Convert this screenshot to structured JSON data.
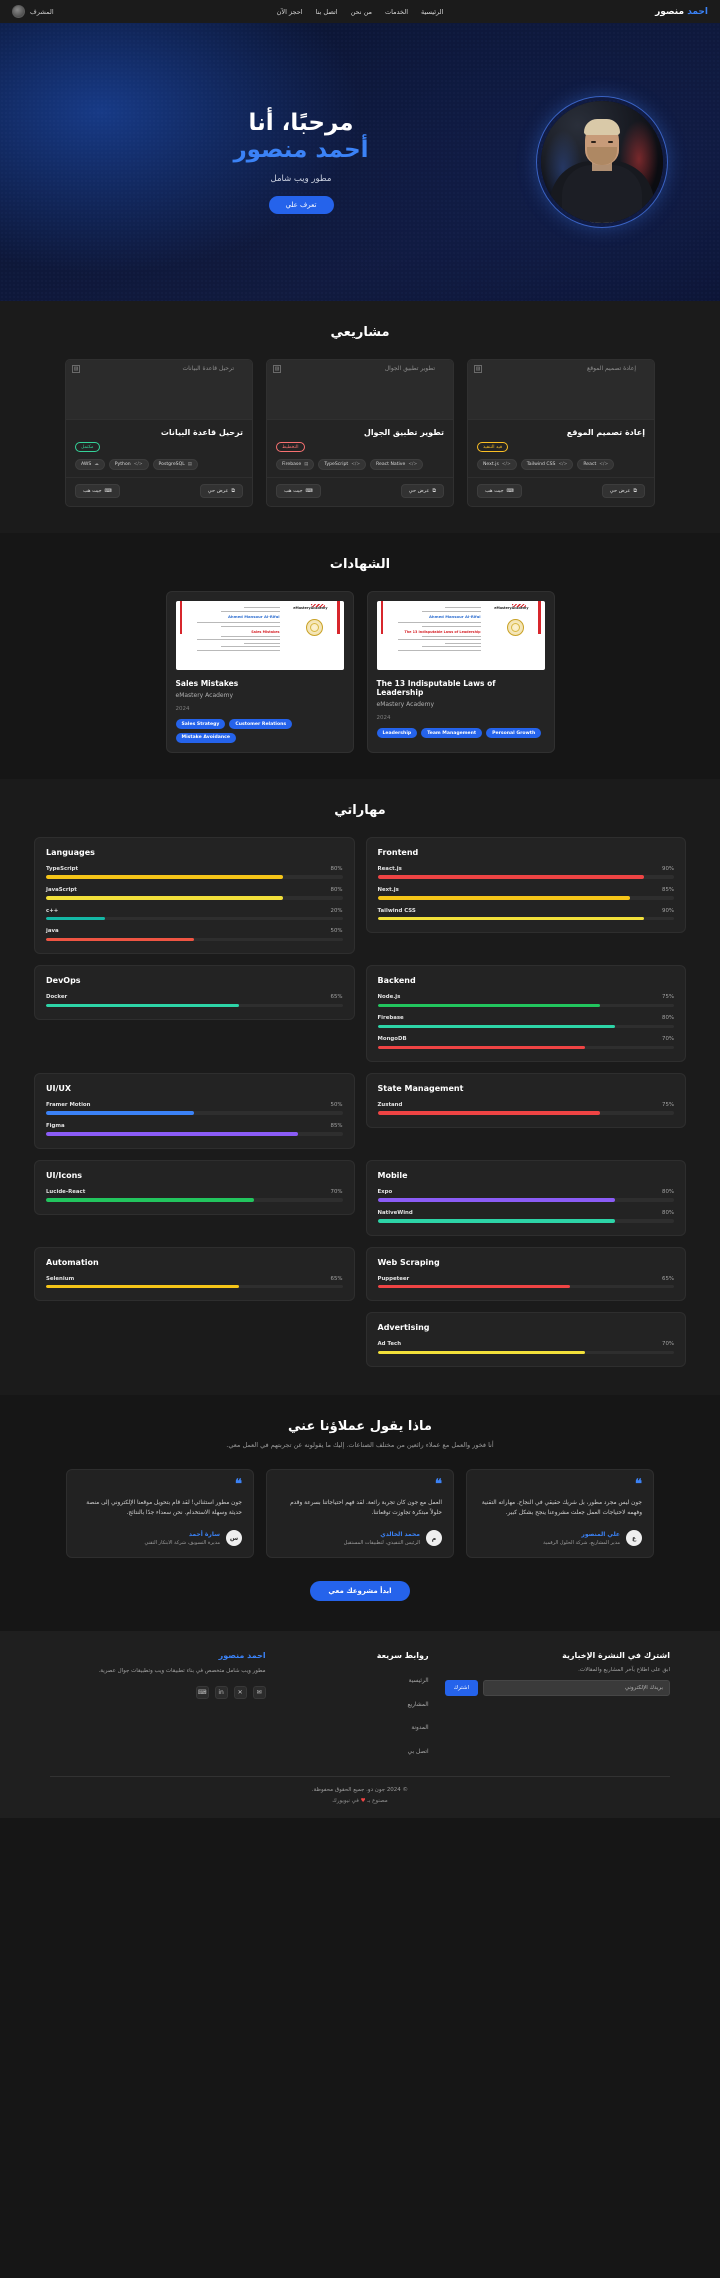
{
  "nav": {
    "logo_first": "احمد",
    "logo_second": "منصور",
    "links": [
      "الرئيسية",
      "الخدمات",
      "من نحن",
      "اتصل بنا",
      "احجز الآن"
    ],
    "user_label": "المشرف",
    "avatar_icon": "user-avatar-icon"
  },
  "hero": {
    "greeting": "مرحبًا، أنا",
    "name": "أحمد منصور",
    "role": "مطور ويب شامل",
    "cta": "تعرف علي",
    "portrait_icon": "profile-portrait"
  },
  "projects": {
    "title": "مشاريعي",
    "items": [
      {
        "title": "إعادة تصميم الموقع",
        "status": "قيد التنفيذ",
        "status_type": "progress",
        "thumb_alt": "إعادة تصميم الموقع",
        "tags": [
          "React",
          "Tailwind CSS",
          "Next.js"
        ],
        "btn_demo": "عرض حي",
        "btn_code": "جيت هب"
      },
      {
        "title": "تطوير تطبيق الجوال",
        "status": "التخطيط",
        "status_type": "planning",
        "thumb_alt": "تطوير تطبيق الجوال",
        "tags": [
          "React Native",
          "TypeScript",
          "Firebase"
        ],
        "btn_demo": "عرض حي",
        "btn_code": "جيت هب"
      },
      {
        "title": "ترحيل قاعدة البيانات",
        "status": "مكتمل",
        "status_type": "done",
        "thumb_alt": "ترحيل قاعدة البيانات",
        "tags": [
          "PostgreSQL",
          "Python",
          "AWS"
        ],
        "btn_demo": "عرض حي",
        "btn_code": "جيت هب"
      }
    ]
  },
  "certificates": {
    "title": "الشهادات",
    "items": [
      {
        "name": "The 13 Indisputable Laws of Leadership",
        "org": "eMastery Academy",
        "year": "2024",
        "tags": [
          "Leadership",
          "Team Management",
          "Personal Growth"
        ],
        "cert_holder": "Ahmed Mansour Al-Rifai",
        "cert_course": "The 13 Indisputable Laws of Leadership",
        "cert_brand": "eMasteryAcademy"
      },
      {
        "name": "Sales Mistakes",
        "org": "eMastery Academy",
        "year": "2024",
        "tags": [
          "Sales Strategy",
          "Customer Relations",
          "Mistake Avoidance"
        ],
        "cert_holder": "Ahmed Mansour Al-Rifai",
        "cert_course": "Sales Mistakes",
        "cert_brand": "eMasteryAcademy"
      }
    ]
  },
  "skills": {
    "title": "مهاراتي",
    "groups": [
      {
        "category": "Frontend",
        "items": [
          {
            "name": "React.js",
            "pct": "90%",
            "value": 90,
            "color": "#ef4444"
          },
          {
            "name": "Next.js",
            "pct": "85%",
            "value": 85,
            "color": "#f5c518"
          },
          {
            "name": "Tailwind CSS",
            "pct": "90%",
            "value": 90,
            "color": "#f2e03a"
          }
        ]
      },
      {
        "category": "Languages",
        "items": [
          {
            "name": "TypeScript",
            "pct": "80%",
            "value": 80,
            "color": "#f5c518"
          },
          {
            "name": "JavaScript",
            "pct": "80%",
            "value": 80,
            "color": "#f2e03a"
          },
          {
            "name": "c++",
            "pct": "20%",
            "value": 20,
            "color": "#14b8a6"
          },
          {
            "name": "java",
            "pct": "50%",
            "value": 50,
            "color": "#ef5543"
          }
        ]
      },
      {
        "category": "Backend",
        "items": [
          {
            "name": "Node.js",
            "pct": "75%",
            "value": 75,
            "color": "#22c55e"
          },
          {
            "name": "Firebase",
            "pct": "80%",
            "value": 80,
            "color": "#2dd4a7"
          },
          {
            "name": "MongoDB",
            "pct": "70%",
            "value": 70,
            "color": "#ef4444"
          }
        ]
      },
      {
        "category": "DevOps",
        "items": [
          {
            "name": "Docker",
            "pct": "65%",
            "value": 65,
            "color": "#2dd4a7"
          }
        ]
      },
      {
        "category": "State Management",
        "items": [
          {
            "name": "Zustand",
            "pct": "75%",
            "value": 75,
            "color": "#ef4444"
          }
        ]
      },
      {
        "category": "UI/UX",
        "items": [
          {
            "name": "Framer Motion",
            "pct": "50%",
            "value": 50,
            "color": "#3b82f6"
          },
          {
            "name": "Figma",
            "pct": "85%",
            "value": 85,
            "color": "#8b5cf6"
          }
        ]
      },
      {
        "category": "Mobile",
        "items": [
          {
            "name": "Expo",
            "pct": "80%",
            "value": 80,
            "color": "#8b5cf6"
          },
          {
            "name": "NativeWind",
            "pct": "80%",
            "value": 80,
            "color": "#2dd4a7"
          }
        ]
      },
      {
        "category": "UI/Icons",
        "items": [
          {
            "name": "Lucide-React",
            "pct": "70%",
            "value": 70,
            "color": "#22c55e"
          }
        ]
      },
      {
        "category": "Web Scraping",
        "items": [
          {
            "name": "Puppeteer",
            "pct": "65%",
            "value": 65,
            "color": "#ef4444"
          }
        ]
      },
      {
        "category": "Automation",
        "items": [
          {
            "name": "Selenium",
            "pct": "65%",
            "value": 65,
            "color": "#f5c518"
          }
        ]
      },
      {
        "category": "Advertising",
        "items": [
          {
            "name": "Ad Tech",
            "pct": "70%",
            "value": 70,
            "color": "#f2e03a"
          }
        ]
      }
    ]
  },
  "testimonials": {
    "title": "ماذا يقول عملاؤنا عني",
    "subtitle": "أنا فخور والعمل مع عملاء رائعين من مختلف الصناعات. إليك ما يقولونه عن تجربتهم في العمل معي.",
    "items": [
      {
        "quote_icon": "quote-icon",
        "text": "جون مطور استثنائي! لقد قام بتحويل موقعنا الإلكتروني إلى منصة حديثة وسهلة الاستخدام. نحن سعداء جدًا بالنتائج.",
        "name": "سارة أحمد",
        "role": "مديرة التسويق، شركة الابتكار التقني",
        "initial": "س"
      },
      {
        "quote_icon": "quote-icon",
        "text": "العمل مع جون كان تجربة رائعة. لقد فهم احتياجاتنا بسرعة وقدم حلولاً مبتكرة تجاوزت توقعاتنا.",
        "name": "محمد الخالدي",
        "role": "الرئيس التنفيذي، لتطبيقات المستقبل",
        "initial": "م"
      },
      {
        "quote_icon": "quote-icon",
        "text": "جون ليس مجرد مطور، بل شريك حقيقي في النجاح. مهاراته التقنية وفهمه لاحتياجات العمل جعلت مشروعنا ينجح بشكل كبير.",
        "name": "علي المنصور",
        "role": "مدير المشاريع، شركة الحلول الرقمية",
        "initial": "ع"
      }
    ],
    "cta": "ابدأ مشروعك معي"
  },
  "footer": {
    "brand": "احمد منصور",
    "brand_desc": "مطور ويب شامل متخصص في بناء تطبيقات ويب وتطبيقات جوال عصرية.",
    "social": [
      {
        "name": "email-icon",
        "glyph": "✉"
      },
      {
        "name": "twitter-icon",
        "glyph": "𝕏"
      },
      {
        "name": "linkedin-icon",
        "glyph": "in"
      },
      {
        "name": "github-icon",
        "glyph": "⌨"
      }
    ],
    "quick_links_title": "روابط سريعة",
    "quick_links": [
      "الرئيسية",
      "المشاريع",
      "المدونة",
      "اتصل بي"
    ],
    "newsletter_title": "اشترك في النشرة الإخبارية",
    "newsletter_desc": "ابق على اطلاع بآخر المشاريع والمقالات.",
    "email_placeholder": "بريدك الإلكتروني",
    "subscribe_label": "اشترك",
    "copyright": "© 2024 جون دو. جميع الحقوق محفوظة.",
    "made_by_pre": "مصنوع بـ",
    "made_by_heart": "♥",
    "made_by_post": "في نيويورك"
  }
}
